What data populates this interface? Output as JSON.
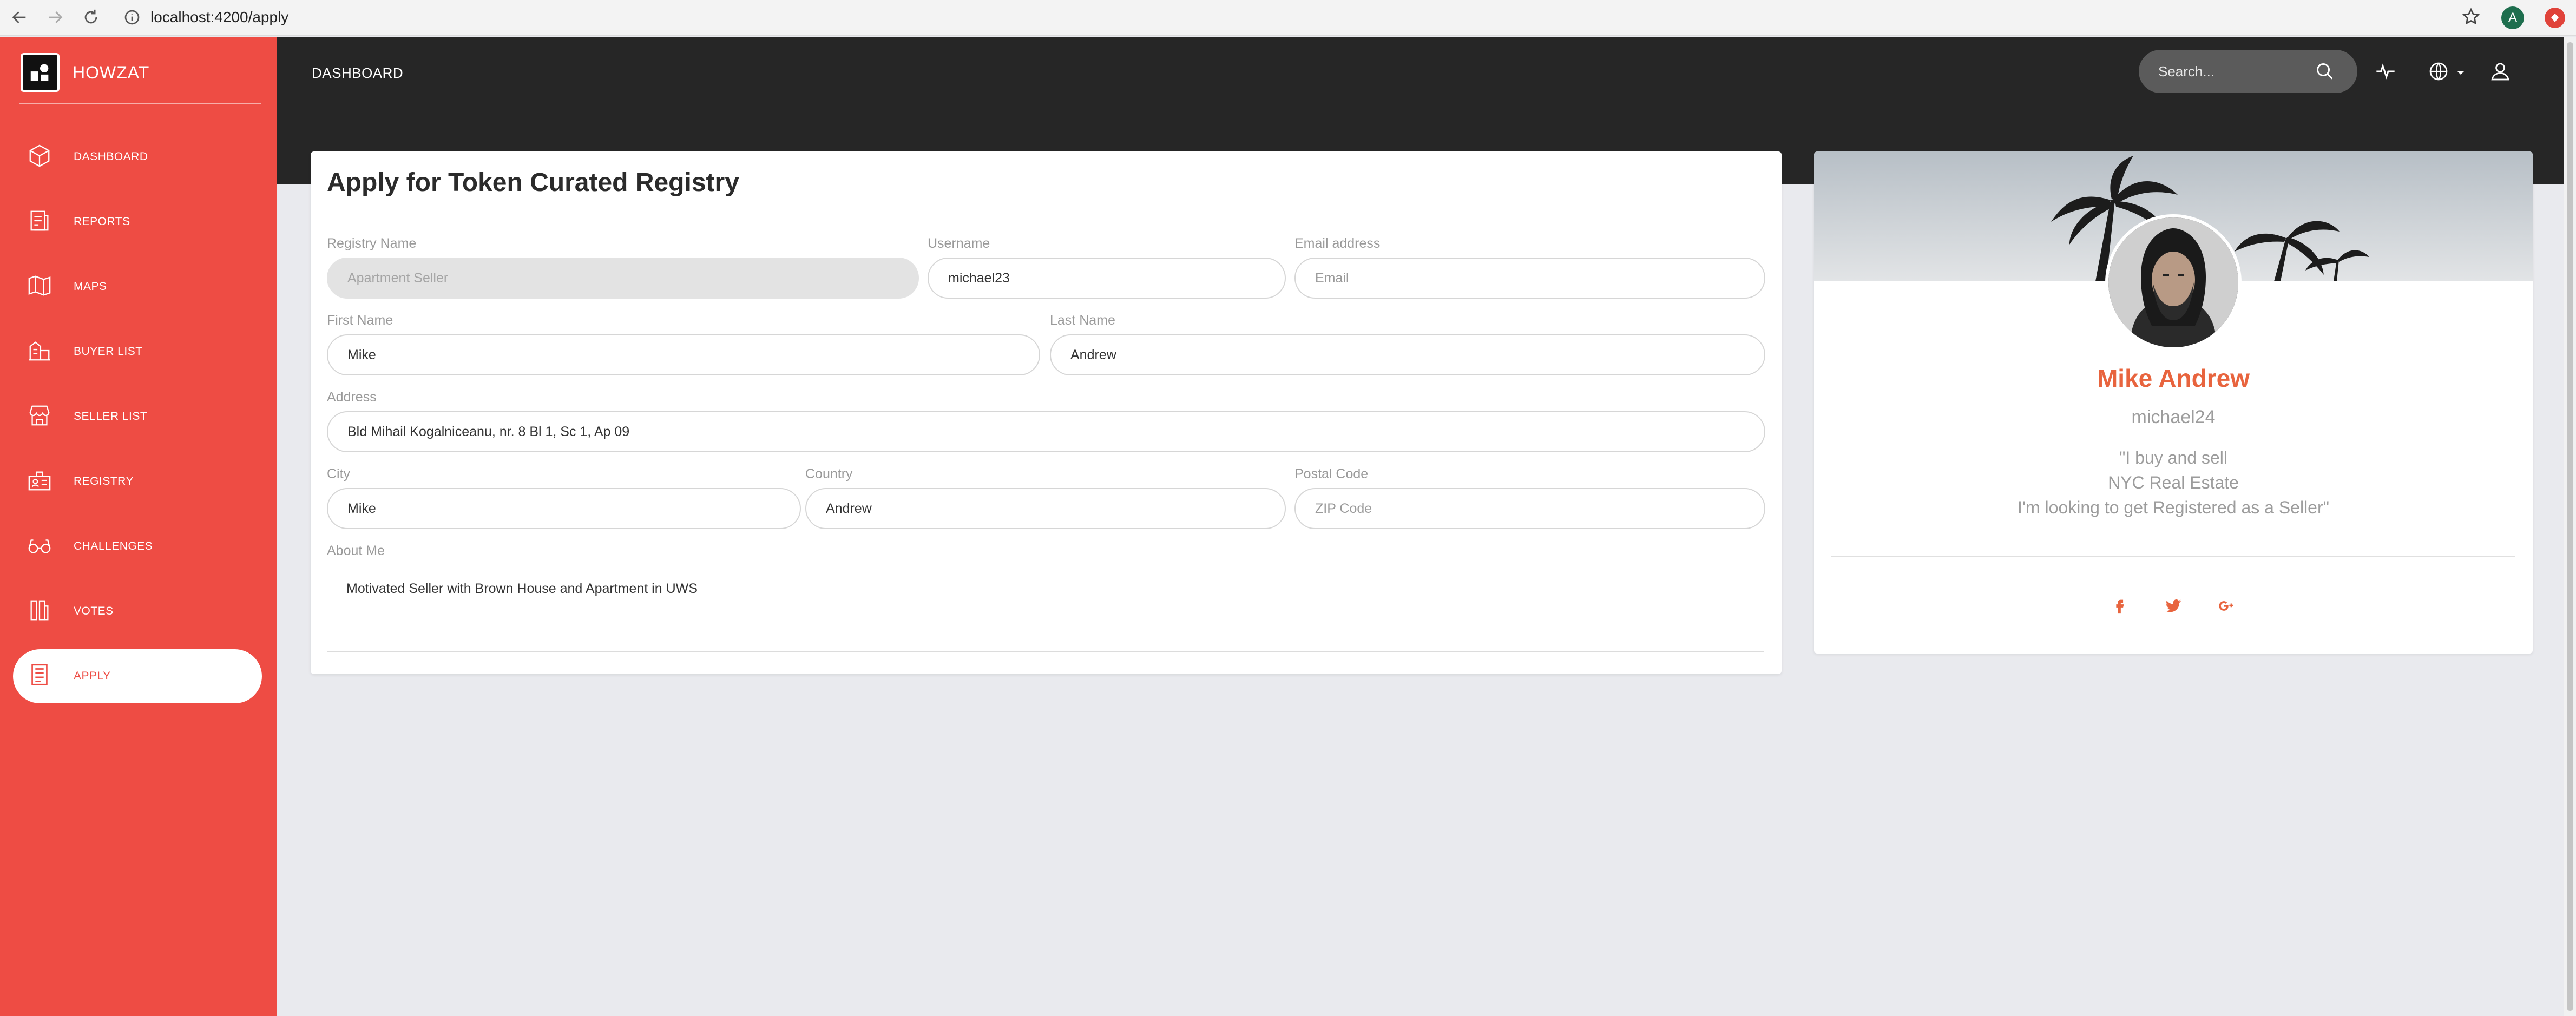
{
  "browser": {
    "url": "localhost:4200/apply",
    "profile_initial": "A"
  },
  "sidebar": {
    "brand": "HOWZAT",
    "items": [
      {
        "label": "DASHBOARD",
        "icon": "box-icon"
      },
      {
        "label": "REPORTS",
        "icon": "report-icon"
      },
      {
        "label": "MAPS",
        "icon": "map-icon"
      },
      {
        "label": "BUYER LIST",
        "icon": "buyer-list-icon"
      },
      {
        "label": "SELLER LIST",
        "icon": "shop-icon"
      },
      {
        "label": "REGISTRY",
        "icon": "registry-icon"
      },
      {
        "label": "CHALLENGES",
        "icon": "glasses-icon"
      },
      {
        "label": "VOTES",
        "icon": "votes-icon"
      },
      {
        "label": "APPLY",
        "icon": "document-icon",
        "active": true
      }
    ]
  },
  "topbar": {
    "title": "DASHBOARD",
    "search_placeholder": "Search..."
  },
  "form": {
    "title": "Apply for Token Curated Registry",
    "registry_name": {
      "label": "Registry Name",
      "value": "Apartment Seller"
    },
    "username": {
      "label": "Username",
      "value": "michael23"
    },
    "email": {
      "label": "Email address",
      "placeholder": "Email"
    },
    "first_name": {
      "label": "First Name",
      "value": "Mike"
    },
    "last_name": {
      "label": "Last Name",
      "value": "Andrew"
    },
    "address": {
      "label": "Address",
      "value": "Bld Mihail Kogalniceanu, nr. 8 Bl 1, Sc 1, Ap 09"
    },
    "city": {
      "label": "City",
      "value": "Mike"
    },
    "country": {
      "label": "Country",
      "value": "Andrew"
    },
    "postal_code": {
      "label": "Postal Code",
      "placeholder": "ZIP Code"
    },
    "about": {
      "label": "About Me",
      "value": "Motivated Seller with Brown House and Apartment in UWS"
    }
  },
  "profile": {
    "name": "Mike Andrew",
    "handle": "michael24",
    "quote": [
      "\"I buy and sell",
      "NYC Real Estate",
      "I'm looking to get Registered as a Seller\""
    ],
    "social": [
      "facebook-icon",
      "twitter-icon",
      "google-plus-icon"
    ]
  },
  "colors": {
    "sidebar": "#ee4c44",
    "topbar": "#262626",
    "accent": "#e8643e",
    "background": "#e9eaee"
  }
}
